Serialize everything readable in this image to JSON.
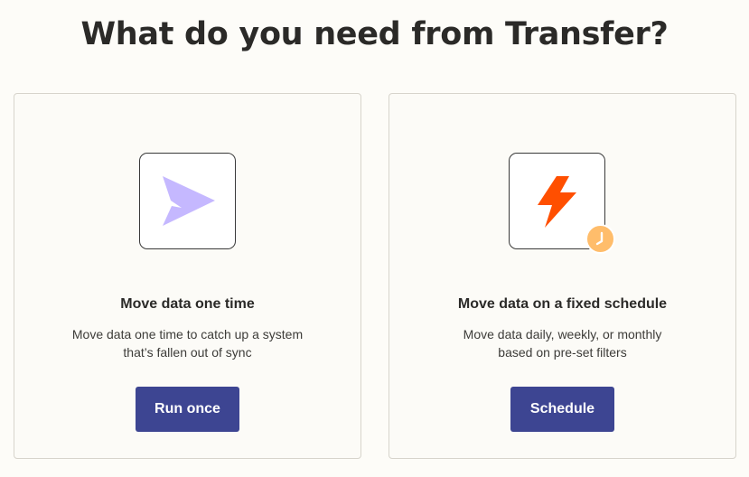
{
  "page": {
    "title": "What do you need from Transfer?"
  },
  "options": [
    {
      "icon": "paper-plane-icon",
      "icon_color": "#c5b8ff",
      "title": "Move data one time",
      "description_line1": "Move data one time to catch up a system",
      "description_line2": "that’s fallen out of sync",
      "button_label": "Run once"
    },
    {
      "icon": "lightning-bolt-icon",
      "icon_color": "#ff4f00",
      "badge_icon": "clock-icon",
      "badge_color": "#ffbd6b",
      "title": "Move data on a fixed schedule",
      "description_line1": "Move data daily, weekly, or monthly",
      "description_line2": "based on pre-set filters",
      "button_label": "Schedule"
    }
  ],
  "colors": {
    "background": "#fdfcf8",
    "button": "#3d4592",
    "text": "#2b2a28"
  }
}
